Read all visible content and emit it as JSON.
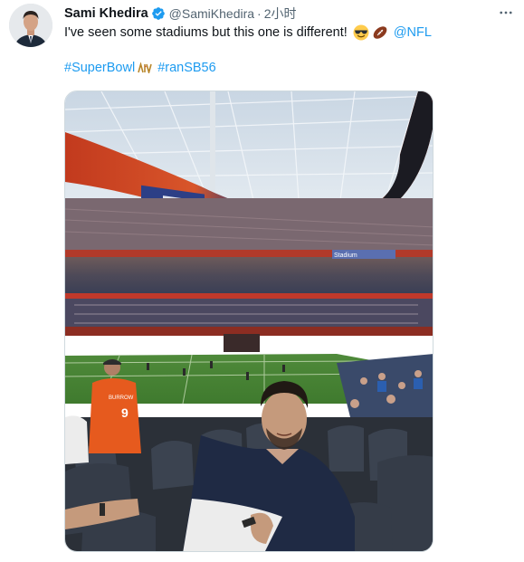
{
  "author": {
    "display_name": "Sami Khedira",
    "handle": "@SamiKhedira",
    "separator": "·",
    "time": "2小时",
    "verified": true,
    "avatar_icon": "profile-photo"
  },
  "tweet": {
    "text": "I've seen some stadiums but this one is different!",
    "emojis": [
      "smiling-face-with-sunglasses",
      "american-football"
    ],
    "mention": "@NFL",
    "hashtags": [
      "#SuperBowl",
      "#ranSB56"
    ]
  },
  "media": {
    "alt": "Photo of a man seated in a stadium at Super Bowl LVI",
    "jersey_name": "BURROW",
    "jersey_number": "9",
    "ribbon_text": "Stadium"
  },
  "colors": {
    "link": "#1d9bf0",
    "verified": "#1d9bf0",
    "secondary_text": "#536471"
  }
}
